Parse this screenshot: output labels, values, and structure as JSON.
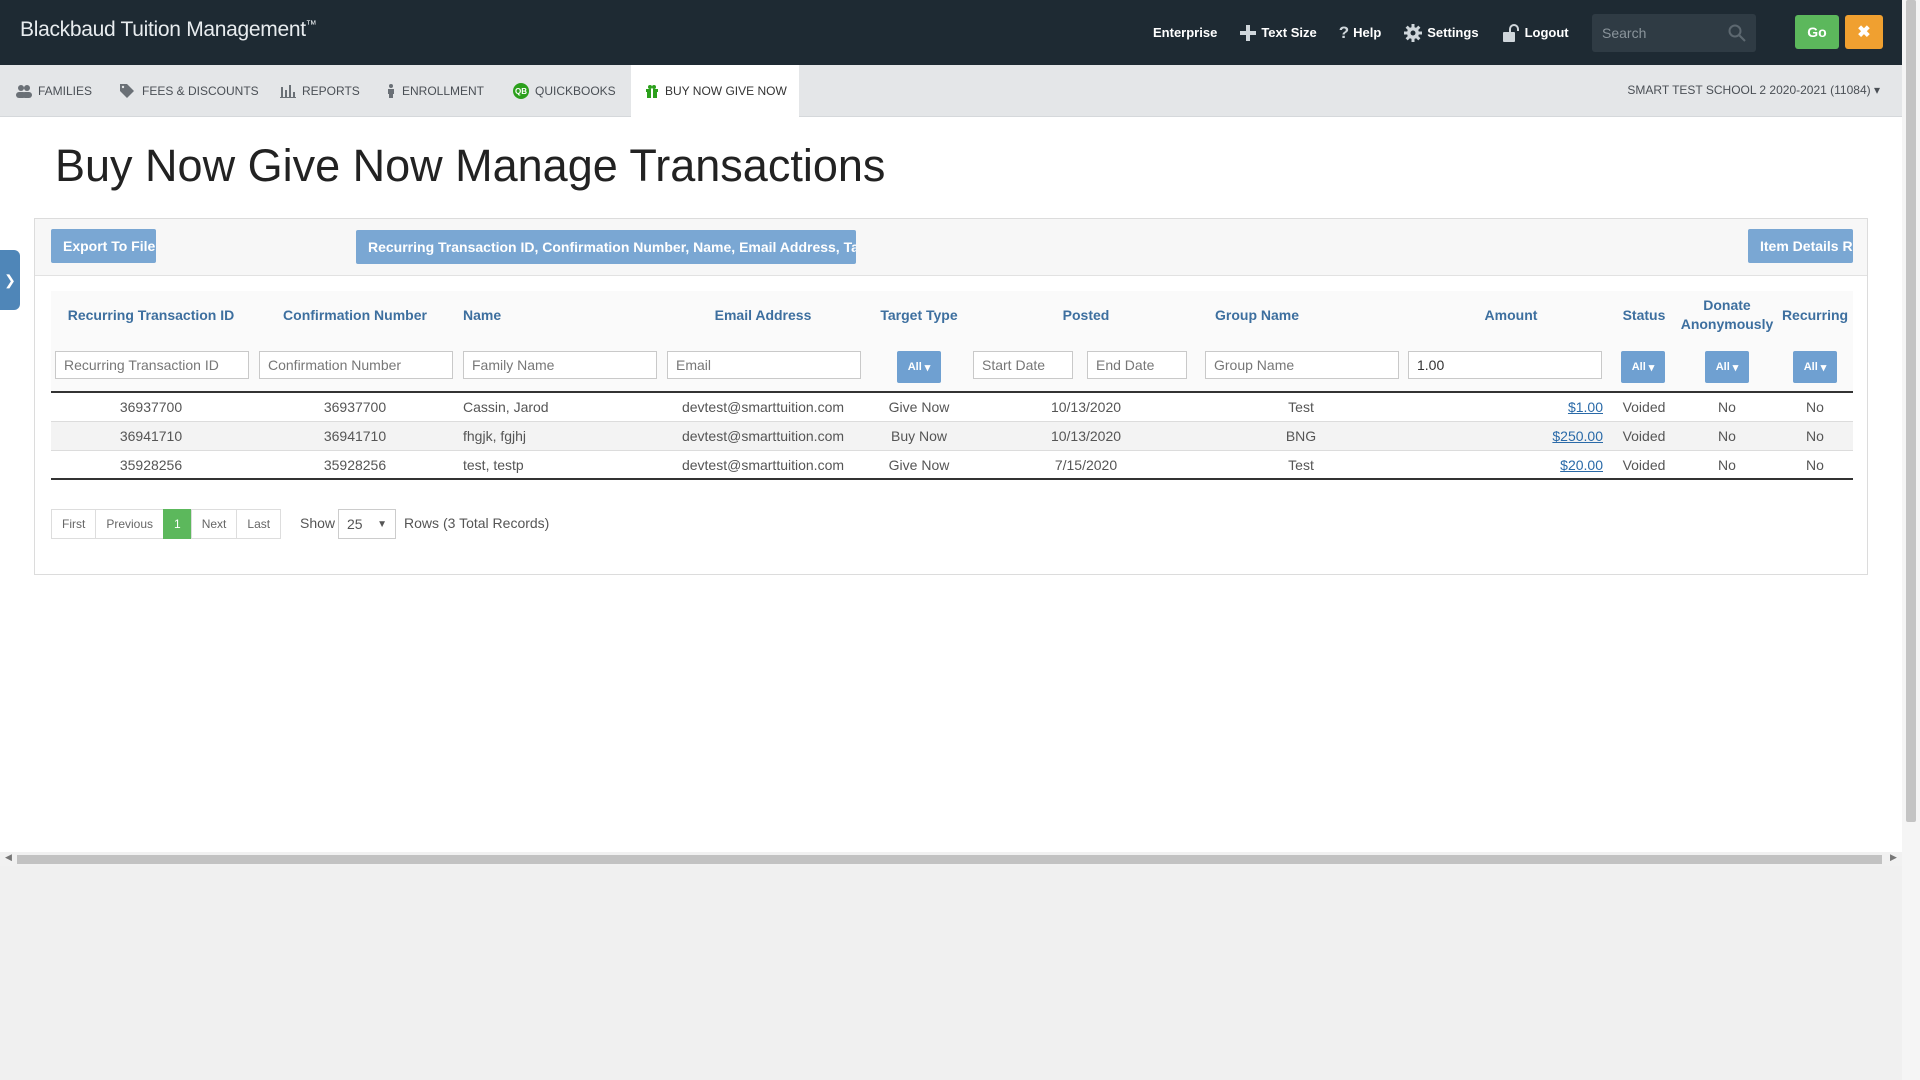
{
  "header": {
    "brand": "Blackbaud Tuition Management",
    "brand_tm": "™",
    "links": {
      "enterprise": "Enterprise",
      "text_size": "Text Size",
      "help": "Help",
      "settings": "Settings",
      "logout": "Logout"
    },
    "search_placeholder": "Search",
    "go_label": "Go",
    "close_label": "✖"
  },
  "nav": {
    "families": "FAMILIES",
    "fees": "FEES & DISCOUNTS",
    "reports": "REPORTS",
    "enrollment": "ENROLLMENT",
    "quickbooks": "QUICKBOOKS",
    "bngn": "BUY NOW GIVE NOW",
    "school": "SMART TEST SCHOOL 2 2020-2021 (11084)"
  },
  "page": {
    "title": "Buy Now Give Now Manage Transactions"
  },
  "toolbar": {
    "export": "Export To File",
    "columns": "Recurring Transaction ID, Confirmation Number, Name, Email Address, Target Type...",
    "item_details": "Item Details Re"
  },
  "table": {
    "headers": {
      "rec_id": "Recurring Transaction ID",
      "conf": "Confirmation Number",
      "name": "Name",
      "email": "Email Address",
      "target": "Target Type",
      "posted": "Posted",
      "group": "Group Name",
      "amount": "Amount",
      "status": "Status",
      "donate": "Donate Anonymously",
      "recurring": "Recurring"
    },
    "filters": {
      "rec_id": "Recurring Transaction ID",
      "conf": "Confirmation Number",
      "name": "Family Name",
      "email": "Email",
      "start": "Start Date",
      "end": "End Date",
      "group": "Group Name",
      "amount_value": "1.00",
      "all": "All"
    },
    "rows": [
      {
        "rec_id": "36937700",
        "conf": "36937700",
        "name": "Cassin, Jarod",
        "email": "devtest@smarttuition.com",
        "target": "Give Now",
        "posted": "10/13/2020",
        "group": "Test",
        "amount": "$1.00",
        "status": "Voided",
        "donate": "No",
        "recurring": "No"
      },
      {
        "rec_id": "36941710",
        "conf": "36941710",
        "name": "fhgjk, fgjhj",
        "email": "devtest@smarttuition.com",
        "target": "Buy Now",
        "posted": "10/13/2020",
        "group": "BNG",
        "amount": "$250.00",
        "status": "Voided",
        "donate": "No",
        "recurring": "No"
      },
      {
        "rec_id": "35928256",
        "conf": "35928256",
        "name": "test, testp",
        "email": "devtest@smarttuition.com",
        "target": "Give Now",
        "posted": "7/15/2020",
        "group": "Test",
        "amount": "$20.00",
        "status": "Voided",
        "donate": "No",
        "recurring": "No"
      }
    ]
  },
  "pager": {
    "first": "First",
    "previous": "Previous",
    "current": "1",
    "next": "Next",
    "last": "Last",
    "show": "Show",
    "page_size": "25",
    "rows": "Rows",
    "total": "(3 Total Records)"
  }
}
